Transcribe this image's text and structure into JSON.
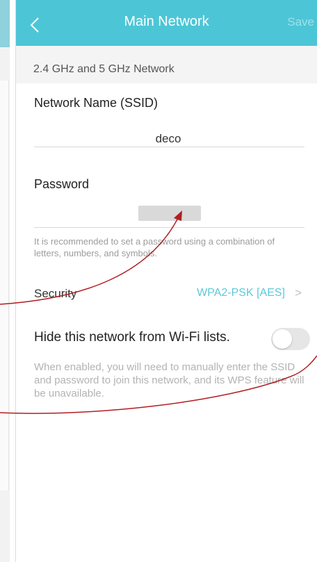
{
  "header": {
    "title": "Main Network",
    "save_label": "Save"
  },
  "section": {
    "title": "2.4 GHz and 5 GHz Network"
  },
  "ssid": {
    "label": "Network Name (SSID)",
    "value": "deco"
  },
  "password": {
    "label": "Password",
    "hint": "It is recommended to set a password using a combination of letters, numbers, and symbols."
  },
  "security": {
    "label": "Security",
    "value": "WPA2-PSK [AES]",
    "chevron": ">"
  },
  "hide_network": {
    "label": "Hide this network from Wi-Fi lists.",
    "enabled": false,
    "description": "When enabled, you will need to manually enter the SSID and password to join this network, and its WPS feature will be unavailable."
  },
  "colors": {
    "accent": "#4cc6d6",
    "annotation": "#b01e23"
  }
}
